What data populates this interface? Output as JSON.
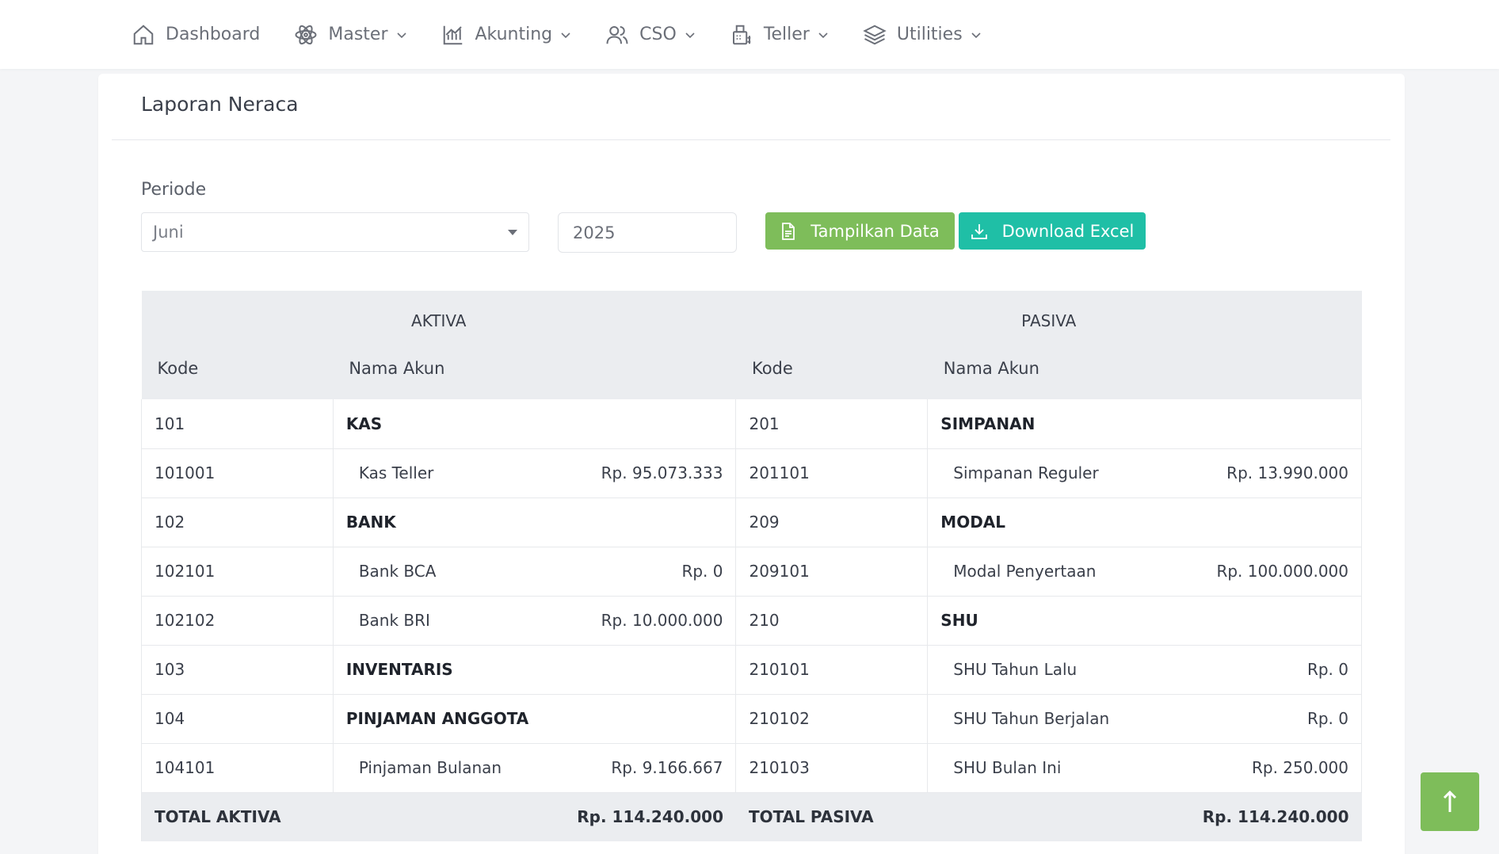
{
  "nav": {
    "items": [
      {
        "label": "Dashboard",
        "icon": "home-icon",
        "dropdown": false
      },
      {
        "label": "Master",
        "icon": "atom-icon",
        "dropdown": true
      },
      {
        "label": "Akunting",
        "icon": "bar-chart-icon",
        "dropdown": true
      },
      {
        "label": "CSO",
        "icon": "users-icon",
        "dropdown": true
      },
      {
        "label": "Teller",
        "icon": "cash-register-icon",
        "dropdown": true
      },
      {
        "label": "Utilities",
        "icon": "layers-icon",
        "dropdown": true
      }
    ]
  },
  "page": {
    "title": "Laporan Neraca",
    "periode_label": "Periode",
    "month_selected": "Juni",
    "year_value": "2025",
    "btn_show": "Tampilkan Data",
    "btn_excel": "Download Excel"
  },
  "table": {
    "aktiva_header": "AKTIVA",
    "pasiva_header": "PASIVA",
    "col_kode": "Kode",
    "col_nama": "Nama Akun",
    "rows": [
      {
        "a_kode": "101",
        "a_nama": "KAS",
        "a_group": true,
        "a_amount": "",
        "p_kode": "201",
        "p_nama": "SIMPANAN",
        "p_group": true,
        "p_amount": ""
      },
      {
        "a_kode": "101001",
        "a_nama": "Kas Teller",
        "a_group": false,
        "a_amount": "Rp. 95.073.333",
        "p_kode": "201101",
        "p_nama": "Simpanan Reguler",
        "p_group": false,
        "p_amount": "Rp. 13.990.000"
      },
      {
        "a_kode": "102",
        "a_nama": "BANK",
        "a_group": true,
        "a_amount": "",
        "p_kode": "209",
        "p_nama": "MODAL",
        "p_group": true,
        "p_amount": ""
      },
      {
        "a_kode": "102101",
        "a_nama": "Bank BCA",
        "a_group": false,
        "a_amount": "Rp. 0",
        "p_kode": "209101",
        "p_nama": "Modal Penyertaan",
        "p_group": false,
        "p_amount": "Rp. 100.000.000"
      },
      {
        "a_kode": "102102",
        "a_nama": "Bank BRI",
        "a_group": false,
        "a_amount": "Rp. 10.000.000",
        "p_kode": "210",
        "p_nama": "SHU",
        "p_group": true,
        "p_amount": ""
      },
      {
        "a_kode": "103",
        "a_nama": "INVENTARIS",
        "a_group": true,
        "a_amount": "",
        "p_kode": "210101",
        "p_nama": "SHU Tahun Lalu",
        "p_group": false,
        "p_amount": "Rp. 0"
      },
      {
        "a_kode": "104",
        "a_nama": "PINJAMAN ANGGOTA",
        "a_group": true,
        "a_amount": "",
        "p_kode": "210102",
        "p_nama": "SHU Tahun Berjalan",
        "p_group": false,
        "p_amount": "Rp. 0"
      },
      {
        "a_kode": "104101",
        "a_nama": "Pinjaman Bulanan",
        "a_group": false,
        "a_amount": "Rp. 9.166.667",
        "p_kode": "210103",
        "p_nama": "SHU Bulan Ini",
        "p_group": false,
        "p_amount": "Rp. 250.000"
      }
    ],
    "total_aktiva_label": "TOTAL AKTIVA",
    "total_aktiva_value": "Rp. 114.240.000",
    "total_pasiva_label": "TOTAL PASIVA",
    "total_pasiva_value": "Rp. 114.240.000"
  },
  "colors": {
    "btn_show": "#7ebd5a",
    "btn_excel": "#1fbfa6",
    "to_top": "#7ebd5a"
  },
  "to_top_icon": "arrow-up-icon"
}
